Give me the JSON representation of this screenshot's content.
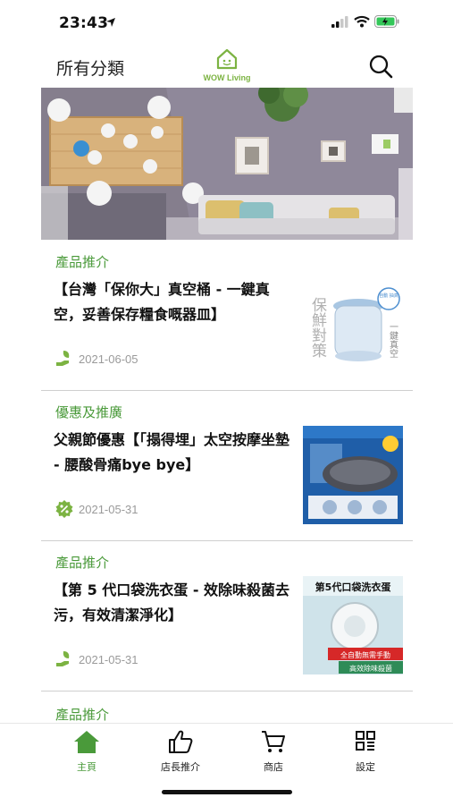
{
  "status_bar": {
    "time": "23:43"
  },
  "header": {
    "category_label": "所有分類",
    "brand": "WOW Living"
  },
  "articles": [
    {
      "category": "產品推介",
      "title": "【台灣「保你大」真空桶 - 一鍵真空，妥善保存糧食嘅器皿】",
      "date": "2021-06-05",
      "icon": "hand-leaf-icon"
    },
    {
      "category": "優惠及推廣",
      "title": "父親節優惠【「搨得埋」太空按摩坐墊 - 腰酸骨痛bye bye】",
      "date": "2021-05-31",
      "icon": "discount-badge-icon"
    },
    {
      "category": "產品推介",
      "title": "【第 5 代口袋洗衣蛋 - 效除味殺菌去污，有效清潔淨化】",
      "date": "2021-05-31",
      "icon": "hand-leaf-icon"
    }
  ],
  "next_category": "產品推介",
  "thumbs": {
    "t1_side": "保鮮對策",
    "t1_badge": "自動 抽真",
    "t1_right": "一鍵真空",
    "t3_top": "第5代口袋洗衣蛋",
    "t3_red": "全自動無需手動",
    "t3_green": "高效除味殺菌"
  },
  "tabs": [
    {
      "label": "主頁",
      "icon": "home-icon",
      "active": true
    },
    {
      "label": "店長推介",
      "icon": "thumbs-up-icon",
      "active": false
    },
    {
      "label": "商店",
      "icon": "cart-icon",
      "active": false
    },
    {
      "label": "設定",
      "icon": "grid-settings-icon",
      "active": false
    }
  ],
  "colors": {
    "accent": "#4a9a3a",
    "divider": "#cfcfcf",
    "date": "#9a9a9a"
  }
}
